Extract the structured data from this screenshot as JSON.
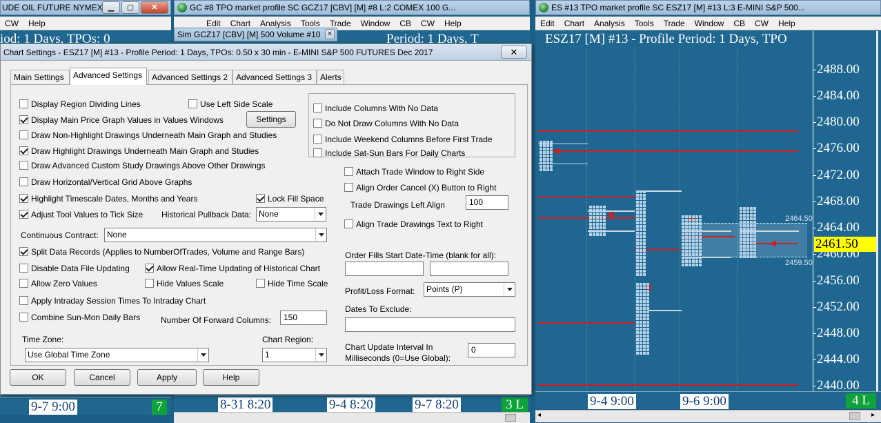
{
  "windows": {
    "crude": {
      "title": "UDE OIL FUTURE NYMEX...",
      "menu": [
        "CW",
        "Help"
      ],
      "header": "iod: 1 Days, TPOs: 0",
      "date": "9-7  9:00",
      "badge": "7"
    },
    "gc": {
      "title": "GC #8 TPO market profile  SC GCZ17 [CBV] [M]  #8  L:2  COMEX 100 G...",
      "menu": [
        "Edit",
        "Chart",
        "Analysis",
        "Tools",
        "Trade",
        "Window",
        "CB",
        "CW",
        "Help"
      ],
      "header": "Period: 1 Days, T",
      "dates": [
        "8-31  8:20",
        "9-4  8:20",
        "9-7  8:20"
      ],
      "badge": "3 L"
    },
    "sim": {
      "title": "Sim GCZ17 [CBV] [M]  500 Volume  #10"
    },
    "es": {
      "title": "ES #13 TPO market profile  SC ESZ17 [M]  #13  L:3  E-MINI S&P 500...",
      "menu": [
        "Edit",
        "Chart",
        "Analysis",
        "Tools",
        "Trade",
        "Window",
        "CB",
        "CW",
        "Help"
      ],
      "header": "ESZ17 [M]  #13 - Profile Period: 1 Days, TPO",
      "axis": [
        "2488.00",
        "2484.00",
        "2480.00",
        "2476.00",
        "2472.00",
        "2468.00",
        "2464.00",
        "2460.00",
        "2456.00",
        "2452.00",
        "2448.00",
        "2444.00",
        "2440.00"
      ],
      "current_price": "2461.50",
      "va_high": "2464.50",
      "va_low": "2459.50",
      "dates": [
        "9-4  9:00",
        "9-6  9:00"
      ],
      "badge": "4 L"
    }
  },
  "dialog": {
    "title": "Chart Settings - ESZ17 [M]  #13 - Profile Period: 1 Days, TPOs: 0.50 x 30 min   - E-MINI S&P 500 FUTURES Dec 2017",
    "close": "✕",
    "tabs": [
      "Main Settings",
      "Advanced Settings",
      "Advanced Settings 2",
      "Advanced Settings 3",
      "Alerts"
    ],
    "checks": {
      "region_lines": {
        "label": "Display Region Dividing Lines",
        "checked": false
      },
      "left_scale": {
        "label": "Use Left Side Scale",
        "checked": false
      },
      "main_price": {
        "label": "Display Main Price Graph Values in Values Windows",
        "checked": true
      },
      "nonhighlight": {
        "label": "Draw Non-Highlight Drawings Underneath Main Graph and Studies",
        "checked": false
      },
      "highlight": {
        "label": "Draw Highlight Drawings Underneath Main Graph and Studies",
        "checked": true
      },
      "adv_custom": {
        "label": "Draw Advanced Custom Study Drawings Above Other Drawings",
        "checked": false
      },
      "grid_above": {
        "label": "Draw Horizontal/Vertical Grid Above Graphs",
        "checked": false
      },
      "timescale": {
        "label": "Highlight Timescale Dates, Months and Years",
        "checked": true
      },
      "lock_fill": {
        "label": "Lock Fill Space",
        "checked": true
      },
      "tick_size": {
        "label": "Adjust Tool Values to Tick Size",
        "checked": true
      },
      "split": {
        "label": "Split Data Records (Applies to NumberOfTrades, Volume and Range Bars)",
        "checked": true
      },
      "disable_update": {
        "label": "Disable Data File Updating",
        "checked": false
      },
      "realtime_hist": {
        "label": "Allow Real-Time Updating of Historical Chart",
        "checked": true
      },
      "zero_values": {
        "label": "Allow Zero Values",
        "checked": false
      },
      "hide_values": {
        "label": "Hide Values Scale",
        "checked": false
      },
      "hide_time": {
        "label": "Hide Time Scale",
        "checked": false
      },
      "intraday_session": {
        "label": "Apply Intraday Session Times To Intraday Chart",
        "checked": false
      },
      "sun_mon": {
        "label": "Combine Sun-Mon Daily Bars",
        "checked": false
      },
      "cols_no_data": {
        "label": "Include Columns With No Data",
        "checked": false
      },
      "no_draw_cols": {
        "label": "Do Not Draw Columns With No Data",
        "checked": false
      },
      "weekend_cols": {
        "label": "Include Weekend Columns Before First Trade",
        "checked": false
      },
      "sat_sun": {
        "label": "Include Sat-Sun Bars For Daily Charts",
        "checked": false
      },
      "attach_trade": {
        "label": "Attach Trade Window to Right Side",
        "checked": false
      },
      "align_cancel": {
        "label": "Align Order Cancel (X) Button to Right",
        "checked": false
      },
      "align_text": {
        "label": "Align Trade Drawings Text to Right",
        "checked": false
      }
    },
    "settings_button": "Settings",
    "hist_pullback_label": "Historical Pullback Data:",
    "hist_pullback_value": "None",
    "continuous_label": "Continuous Contract:",
    "continuous_value": "None",
    "forward_cols_label": "Number Of Forward Columns:",
    "forward_cols_value": "150",
    "timezone_label": "Time Zone:",
    "timezone_value": "Use Global Time Zone",
    "region_label": "Chart Region:",
    "region_value": "1",
    "trade_left_label": "Trade Drawings Left Align",
    "trade_left_value": "100",
    "order_fills_label": "Order Fills Start Date-Time (blank for all):",
    "order_fills_from": "",
    "order_fills_to": "",
    "pl_label": "Profit/Loss Format:",
    "pl_value": "Points (P)",
    "dates_exclude_label": "Dates To Exclude:",
    "dates_exclude_value": "",
    "update_interval_label1": "Chart Update Interval In",
    "update_interval_label2": "Milliseconds (0=Use Global):",
    "update_interval_value": "0",
    "buttons": {
      "ok": "OK",
      "cancel": "Cancel",
      "apply": "Apply",
      "help": "Help"
    }
  }
}
